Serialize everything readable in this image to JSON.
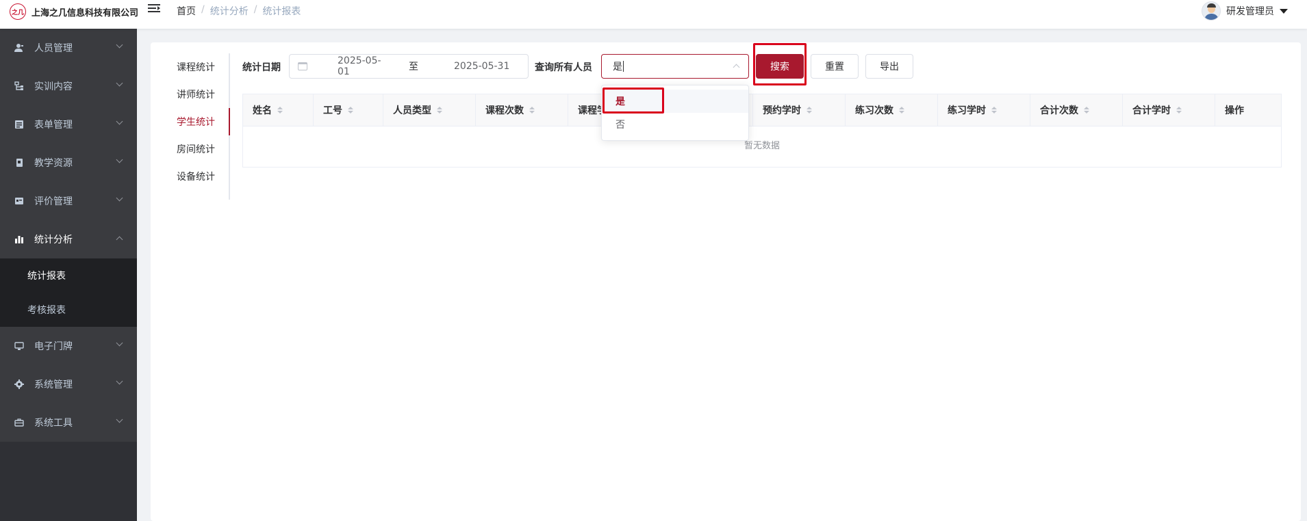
{
  "header": {
    "company": "上海之几信息科技有限公司",
    "logo_text": "之几",
    "breadcrumb": [
      "首页",
      "统计分析",
      "统计报表"
    ],
    "user": "研发管理员"
  },
  "sidebar": {
    "items": [
      {
        "label": "人员管理",
        "icon": "user-icon"
      },
      {
        "label": "实训内容",
        "icon": "tree-icon"
      },
      {
        "label": "表单管理",
        "icon": "form-icon"
      },
      {
        "label": "教学资源",
        "icon": "book-icon"
      },
      {
        "label": "评价管理",
        "icon": "rating-icon"
      },
      {
        "label": "统计分析",
        "icon": "bar-chart-icon"
      },
      {
        "label": "电子门牌",
        "icon": "monitor-icon"
      },
      {
        "label": "系统管理",
        "icon": "gear-icon"
      },
      {
        "label": "系统工具",
        "icon": "toolbox-icon"
      }
    ],
    "submenu": [
      "统计报表",
      "考核报表"
    ]
  },
  "tabs": [
    "课程统计",
    "讲师统计",
    "学生统计",
    "房间统计",
    "设备统计"
  ],
  "filters": {
    "date_label": "统计日期",
    "start_date": "2025-05-01",
    "range_sep": "至",
    "end_date": "2025-05-31",
    "all_label": "查询所有人员",
    "all_value": "是"
  },
  "buttons": {
    "search": "搜索",
    "reset": "重置",
    "export": "导出"
  },
  "dropdown": {
    "options": [
      "是",
      "否"
    ],
    "selected": "是"
  },
  "table": {
    "columns": [
      "姓名",
      "工号",
      "人员类型",
      "课程次数",
      "课程学",
      "预约学时",
      "练习次数",
      "练习学时",
      "合计次数",
      "合计学时",
      "操作"
    ],
    "empty_text": "暂无数据"
  },
  "colors": {
    "accent": "#a8192e",
    "sidebar_bg": "#2f3035",
    "highlight": "#d9001b"
  }
}
